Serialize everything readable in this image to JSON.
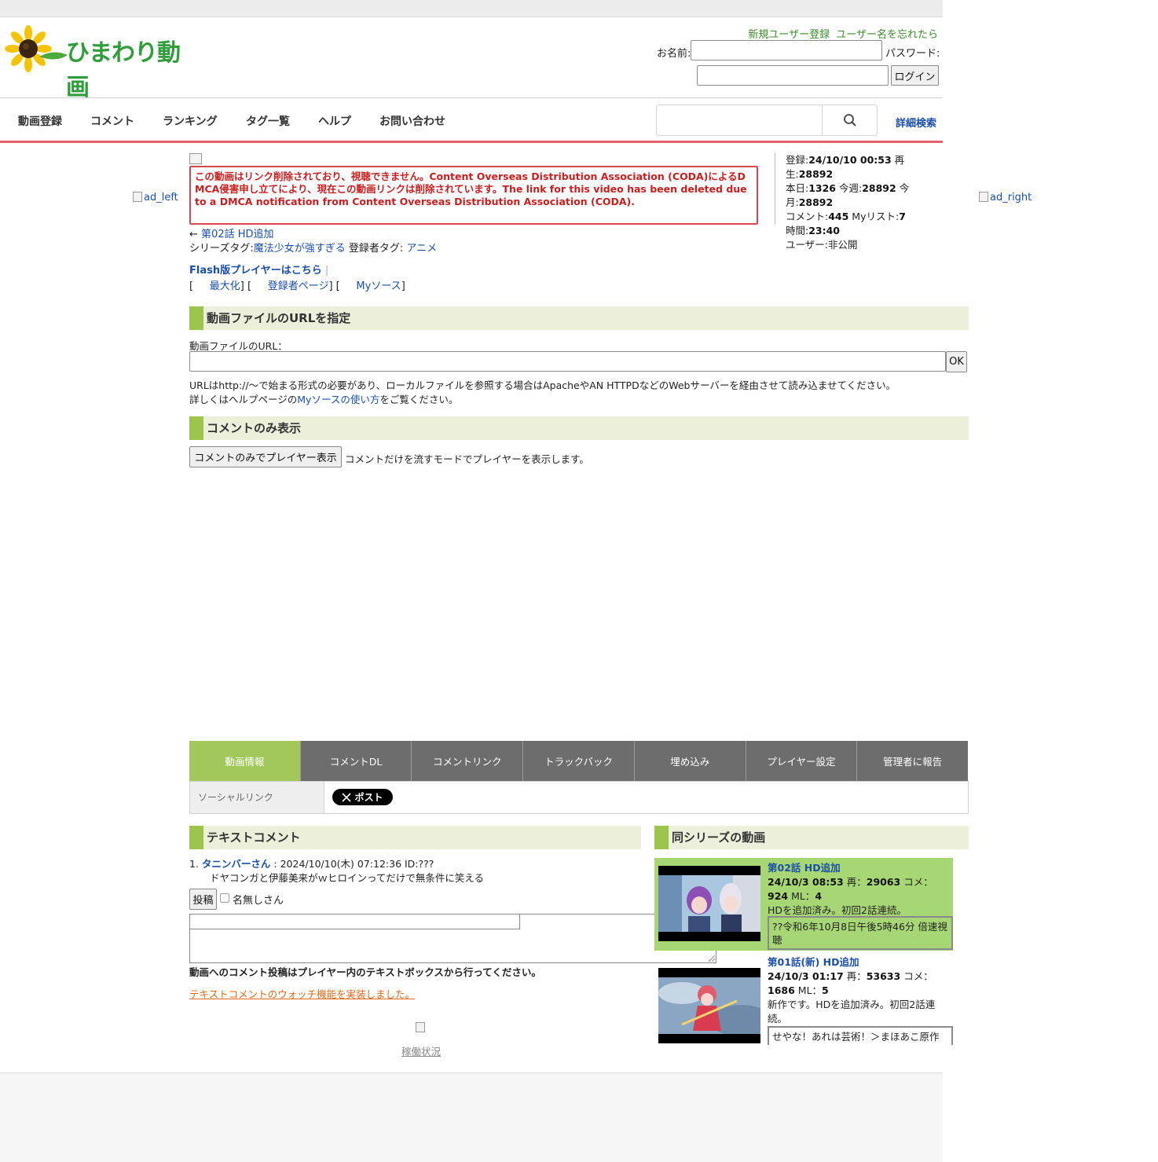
{
  "header": {
    "logo_text": "ひまわり動画",
    "register_link": "新規ユーザー登録",
    "forgot_link": "ユーザー名を忘れたら",
    "name_label": "お名前:",
    "password_label": "パスワード:",
    "login_button": "ログイン"
  },
  "nav": {
    "items": [
      "動画登録",
      "コメント",
      "ランキング",
      "タグ一覧",
      "ヘルプ",
      "お問い合わせ"
    ],
    "advanced_search": "詳細検索"
  },
  "ads": {
    "left": "ad_left",
    "right": "ad_right"
  },
  "notice": {
    "text": "この動画はリンク削除されており、視聴できません。Content Overseas Distribution Association (CODA)によるDMCA侵害申し立てにより、現在この動画リンクは削除されています。The link for this video has been deleted due to a DMCA notification from Content Overseas Distribution Association (CODA)."
  },
  "stats": {
    "reg_label": "登録:",
    "reg_value": "24/10/10 00:53",
    "play_label": "再生:",
    "play_value": "28892",
    "today_label": "本日:",
    "today_value": "1326",
    "week_label": "今週:",
    "week_value": "28892",
    "month_label": "今月:",
    "month_value": "28892",
    "comment_label": "コメント:",
    "comment_value": "445",
    "mylist_label": "Myリスト:",
    "mylist_value": "7",
    "duration_label": "時間:",
    "duration_value": "23:40",
    "user_label": "ユーザー:",
    "user_value": "非公開"
  },
  "video": {
    "prev_arrow": "←",
    "prev_link": "第02話 HD追加",
    "series_tag_label": "シリーズタグ:",
    "series_tag": "魔法少女が強すぎる",
    "user_tag_label": "登録者タグ:",
    "user_tag": "アニメ",
    "flash_link": "Flash版プレイヤーはこちら",
    "flash_sep": "|",
    "bracket_open": "[",
    "maximize": "最大化",
    "bracket_mid1": "] [",
    "uploader_page": "登録者ページ",
    "bracket_mid2": "] [",
    "my_source": "Myソース",
    "bracket_close": "]"
  },
  "url_section": {
    "title": "動画ファイルのURLを指定",
    "label": "動画ファイルのURL：",
    "ok_button": "OK",
    "note1": "URLはhttp://～で始まる形式の必要があり、ローカルファイルを参照する場合はApacheやAN HTTPDなどのWebサーバーを経由させて読み込ませてください。",
    "note2_prefix": "詳しくはヘルプページの",
    "note2_link": "Myソースの使い方",
    "note2_suffix": "をご覧ください。"
  },
  "comment_only": {
    "title": "コメントのみ表示",
    "button": "コメントのみでプレイヤー表示",
    "desc": "コメントだけを流すモードでプレイヤーを表示します。"
  },
  "tabs": [
    "動画情報",
    "コメントDL",
    "コメントリンク",
    "トラックバック",
    "埋め込み",
    "プレイヤー設定",
    "管理者に報告"
  ],
  "social": {
    "label": "ソーシャルリンク",
    "post_button": "ポスト",
    "x_icon": "x-logo-icon"
  },
  "text_comment": {
    "title": "テキストコメント",
    "entry_num": "1.",
    "entry_author": "タニンバーさん",
    "entry_meta": ": 2024/10/10(木) 07:12:36 ID:???",
    "entry_body": "ドヤコンガと伊藤美来がｗヒロインってだけで無条件に笑える",
    "post_button": "投稿",
    "anon_label": "名無しさん",
    "note": "動画へのコメント投稿はプレイヤー内のテキストボックスから行ってください。",
    "watch_link": "テキストコメントのウォッチ機能を実装しました。",
    "uptime": "稼働状況"
  },
  "series": {
    "title": "同シリーズの動画",
    "items": [
      {
        "title": "第02話 HD追加",
        "date": "24/10/3 08:53",
        "play_label": "再：",
        "play": "29063",
        "comment_label": "コメ：",
        "comment": "924",
        "ml_label": "ML：",
        "ml": "4",
        "desc": "HDを追加済み。初回2話連続。",
        "latest_comment": "??令和6年10月8日午後5時46分 倍速視聴"
      },
      {
        "title": "第01話(新) HD追加",
        "date": "24/10/3 01:17",
        "play_label": "再：",
        "play": "53633",
        "comment_label": "コメ：",
        "comment": "1686",
        "ml_label": "ML：",
        "ml": "5",
        "desc": "新作です。HDを追加済み。初回2話連続。",
        "latest_comment": "せやな！あれは芸術！＞まほあこ原作"
      }
    ]
  },
  "colors": {
    "accent_green": "#9bc64b",
    "active_tab": "#a2c85b",
    "nav_underline": "#e4606d",
    "notice_red": "#c81e1e",
    "link_blue": "#1a4fa8"
  }
}
